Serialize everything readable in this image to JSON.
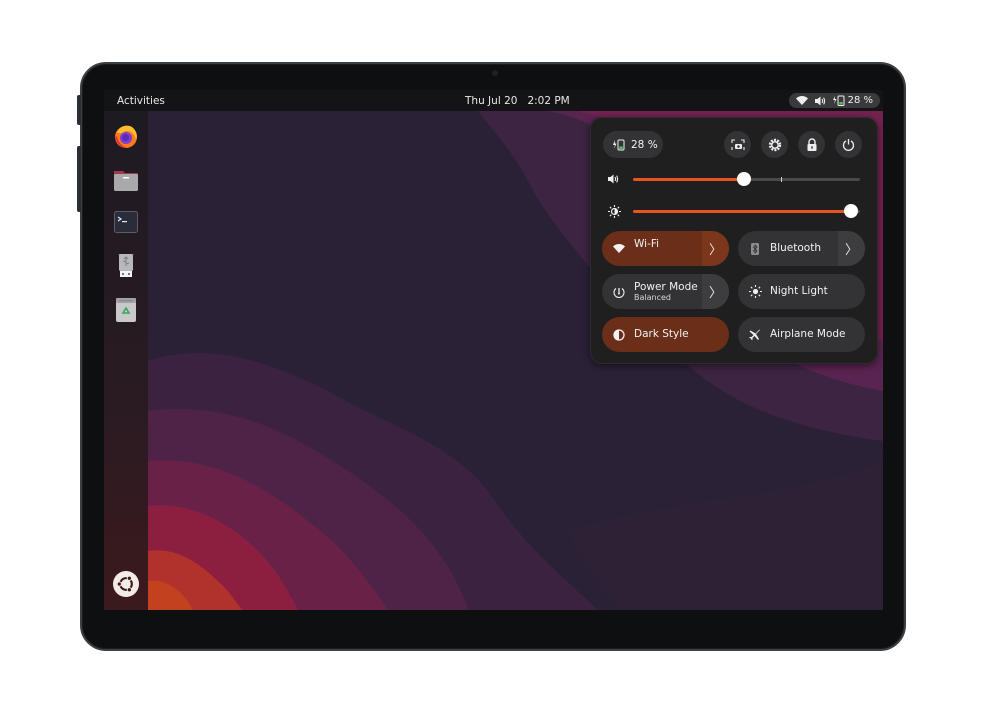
{
  "topbar": {
    "activities_label": "Activities",
    "date": "Thu Jul 20",
    "time": "2:02 PM",
    "tray": {
      "icons": [
        "wifi-icon",
        "volume-icon",
        "battery-icon"
      ],
      "battery_percent": "28 %"
    }
  },
  "dock": {
    "items": [
      {
        "name": "Firefox",
        "icon": "firefox-icon"
      },
      {
        "name": "Files",
        "icon": "folder-icon"
      },
      {
        "name": "Terminal",
        "icon": "terminal-icon"
      },
      {
        "name": "USB Drive",
        "icon": "usb-drive-icon"
      },
      {
        "name": "Trash",
        "icon": "trash-icon"
      }
    ],
    "show_apps": {
      "name": "Show Applications",
      "icon": "ubuntu-logo-icon"
    }
  },
  "quick_settings": {
    "battery_label": "28 %",
    "header_buttons": [
      {
        "name": "Screenshot",
        "icon": "screenshot-icon"
      },
      {
        "name": "Settings",
        "icon": "gear-icon"
      },
      {
        "name": "Lock",
        "icon": "lock-icon"
      },
      {
        "name": "Power",
        "icon": "power-icon"
      }
    ],
    "volume": {
      "icon": "volume-icon",
      "value_percent": 49,
      "marker_percent": 65
    },
    "brightness": {
      "icon": "brightness-icon",
      "value_percent": 96
    },
    "tiles": [
      {
        "label": "Wi-Fi",
        "sublabel": "",
        "icon": "wifi-icon",
        "active": true,
        "has_arrow": true,
        "arrow": "〉"
      },
      {
        "label": "Bluetooth",
        "sublabel": "",
        "icon": "bluetooth-icon",
        "active": false,
        "has_arrow": true,
        "arrow": "〉"
      },
      {
        "label": "Power Mode",
        "sublabel": "Balanced",
        "icon": "power-mode-icon",
        "active": false,
        "has_arrow": true,
        "arrow": "〉"
      },
      {
        "label": "Night Light",
        "sublabel": "",
        "icon": "night-light-icon",
        "active": false,
        "has_arrow": false
      },
      {
        "label": "Dark Style",
        "sublabel": "",
        "icon": "dark-style-icon",
        "active": true,
        "has_arrow": false
      },
      {
        "label": "Airplane Mode",
        "sublabel": "",
        "icon": "airplane-icon",
        "active": false,
        "has_arrow": false
      }
    ]
  },
  "colors": {
    "accent": "#e95420",
    "tile_active": "#6b2e18",
    "tile_inactive": "#333335",
    "panel_bg": "#1f1f20",
    "topbar_bg": "#141416"
  }
}
